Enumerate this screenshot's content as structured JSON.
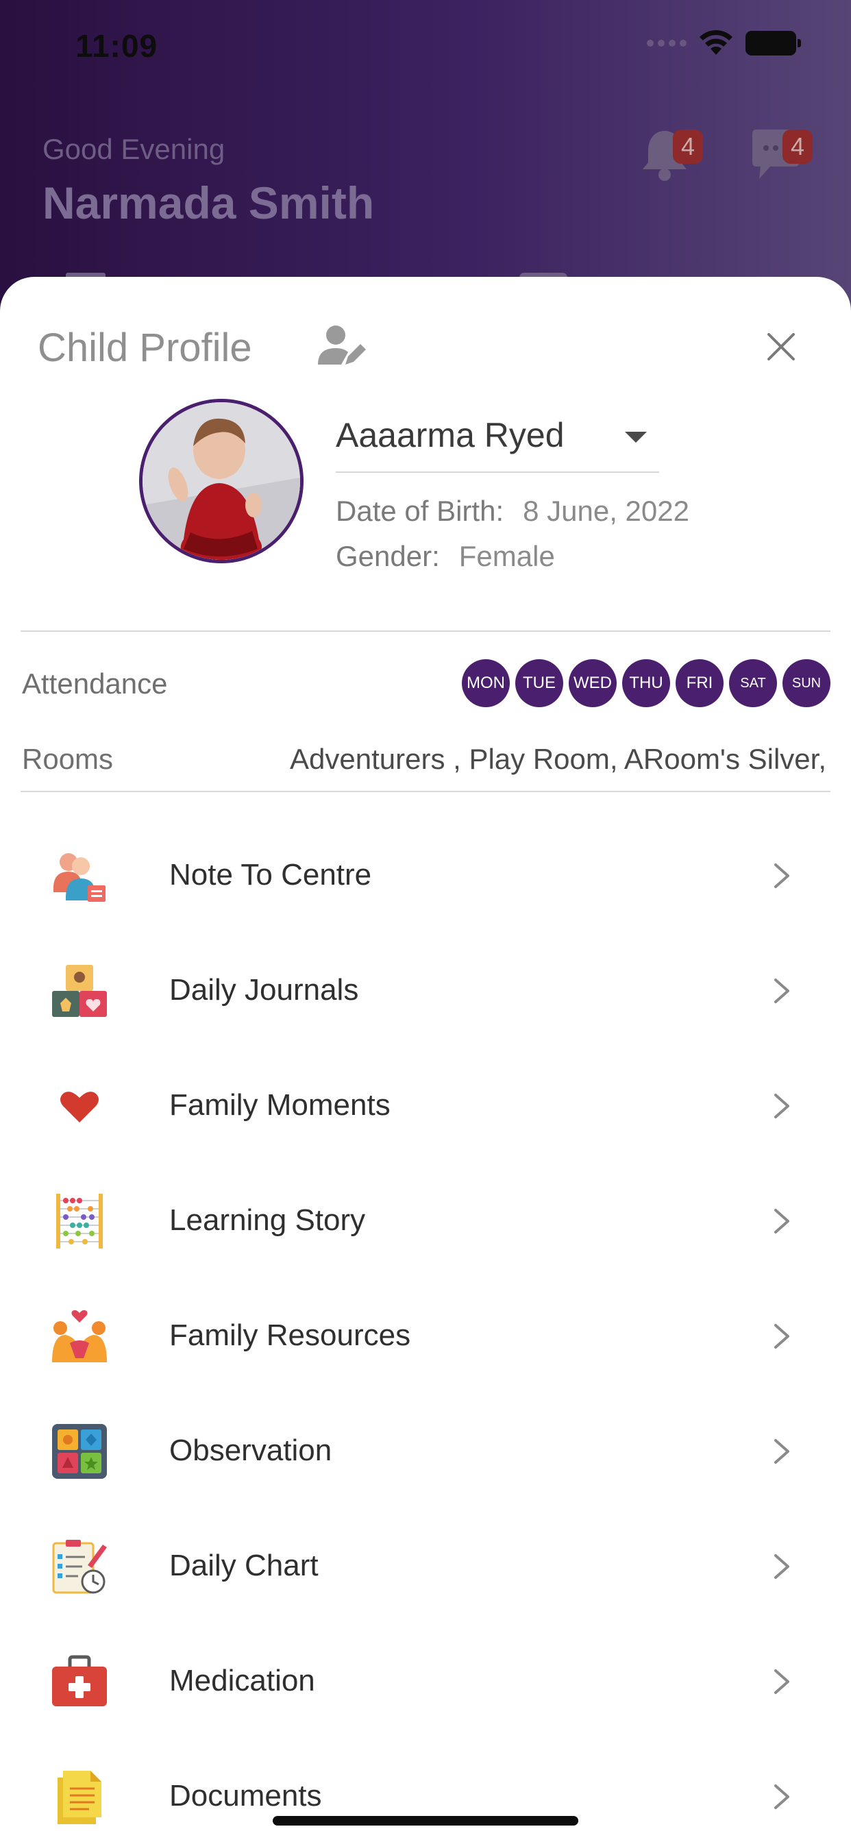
{
  "status_bar": {
    "time": "11:09"
  },
  "header": {
    "greeting": "Good Evening",
    "user_name": "Narmada Smith",
    "notifications_count": "4",
    "messages_count": "4"
  },
  "sheet": {
    "title": "Child Profile",
    "child": {
      "name": "Aaaarma Ryed",
      "dob_label": "Date of Birth:",
      "dob_value": "8 June, 2022",
      "gender_label": "Gender:",
      "gender_value": "Female"
    },
    "attendance": {
      "label": "Attendance",
      "days": [
        "MON",
        "TUE",
        "WED",
        "THU",
        "FRI",
        "SAT",
        "SUN"
      ]
    },
    "rooms": {
      "label": "Rooms",
      "value": "Adventurers , Play Room, ARoom's Silver,"
    },
    "menu": [
      {
        "label": "Note To Centre",
        "icon": "people-note-icon"
      },
      {
        "label": "Daily Journals",
        "icon": "toy-blocks-icon"
      },
      {
        "label": "Family Moments",
        "icon": "heart-icon"
      },
      {
        "label": "Learning Story",
        "icon": "abacus-icon"
      },
      {
        "label": "Family Resources",
        "icon": "family-hands-icon"
      },
      {
        "label": "Observation",
        "icon": "shapes-board-icon"
      },
      {
        "label": "Daily Chart",
        "icon": "checklist-clock-icon"
      },
      {
        "label": "Medication",
        "icon": "medical-kit-icon"
      },
      {
        "label": "Documents",
        "icon": "document-icon"
      }
    ]
  },
  "colors": {
    "accent": "#4a1f6e",
    "badge": "#8e2a2a"
  }
}
